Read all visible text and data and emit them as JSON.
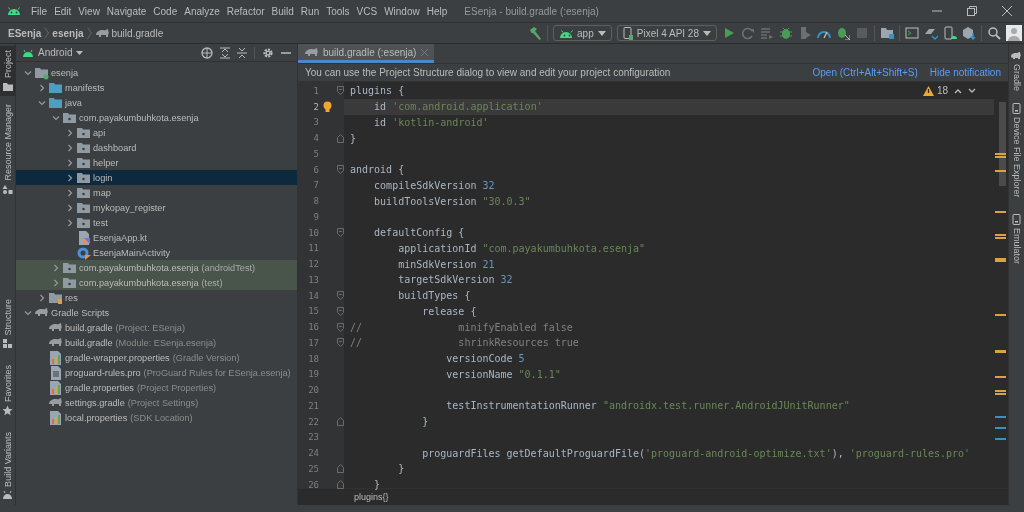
{
  "window": {
    "title": "ESenja - build.gradle (:esenja)"
  },
  "menu": [
    "File",
    "Edit",
    "View",
    "Navigate",
    "Code",
    "Analyze",
    "Refactor",
    "Build",
    "Run",
    "Tools",
    "VCS",
    "Window",
    "Help"
  ],
  "breadcrumb": [
    "ESenja",
    "esenja",
    "build.gradle"
  ],
  "toolbar": {
    "run_config": "app",
    "device": "Pixel 4 API 28"
  },
  "left_tool_tabs": [
    {
      "label": "Project",
      "selected": true,
      "kind": "folder"
    },
    {
      "label": "Resource Manager",
      "selected": false,
      "kind": "shapes"
    },
    {
      "label": "Structure",
      "selected": false,
      "kind": "structure"
    },
    {
      "label": "Favorites",
      "selected": false,
      "kind": "star"
    },
    {
      "label": "Build Variants",
      "selected": false,
      "kind": "android"
    }
  ],
  "right_tool_tabs": [
    {
      "label": "Gradle",
      "selected": false,
      "kind": "gradle"
    },
    {
      "label": "Device File Explorer",
      "selected": false,
      "kind": "device"
    },
    {
      "label": "Emulator",
      "selected": false,
      "kind": "device"
    }
  ],
  "project_panel": {
    "view": "Android",
    "tree": [
      {
        "label": "esenja",
        "kind": "module",
        "expanded": true,
        "selected": false,
        "children": [
          {
            "label": "manifests",
            "kind": "source-folder",
            "expanded": false,
            "selected": false
          },
          {
            "label": "java",
            "kind": "source-folder",
            "expanded": true,
            "selected": false,
            "children": [
              {
                "label": "com.payakumbuhkota.esenja",
                "kind": "package",
                "expanded": true,
                "selected": false,
                "children": [
                  {
                    "label": "api",
                    "kind": "package",
                    "expanded": false,
                    "selected": false
                  },
                  {
                    "label": "dashboard",
                    "kind": "package",
                    "expanded": false,
                    "selected": false
                  },
                  {
                    "label": "helper",
                    "kind": "package",
                    "expanded": false,
                    "selected": false
                  },
                  {
                    "label": "login",
                    "kind": "package",
                    "expanded": false,
                    "selected": true
                  },
                  {
                    "label": "map",
                    "kind": "package",
                    "expanded": false,
                    "selected": false
                  },
                  {
                    "label": "mykopay_register",
                    "kind": "package",
                    "expanded": false,
                    "selected": false
                  },
                  {
                    "label": "test",
                    "kind": "package",
                    "expanded": false,
                    "selected": false
                  },
                  {
                    "label": "EsenjaApp.kt",
                    "kind": "kotlin-file",
                    "selected": false
                  },
                  {
                    "label": "EsenjaMainActivity",
                    "kind": "activity",
                    "selected": false
                  }
                ]
              },
              {
                "label": "com.payakumbuhkota.esenja",
                "hint": "(androidTest)",
                "kind": "test-package",
                "expanded": false,
                "selected": false
              },
              {
                "label": "com.payakumbuhkota.esenja",
                "hint": "(test)",
                "kind": "test-package",
                "expanded": false,
                "selected": false
              }
            ]
          },
          {
            "label": "res",
            "kind": "res-folder",
            "expanded": false,
            "selected": false
          }
        ]
      },
      {
        "label": "Gradle Scripts",
        "kind": "gradle",
        "expanded": true,
        "selected": false,
        "children": [
          {
            "label": "build.gradle",
            "hint": "(Project: ESenja)",
            "kind": "gradle",
            "selected": false
          },
          {
            "label": "build.gradle",
            "hint": "(Module: ESenja.esenja)",
            "kind": "gradle",
            "selected": false
          },
          {
            "label": "gradle-wrapper.properties",
            "hint": "(Gradle Version)",
            "kind": "properties",
            "selected": false
          },
          {
            "label": "proguard-rules.pro",
            "hint": "(ProGuard Rules for ESenja.esenja)",
            "kind": "text-file",
            "selected": false
          },
          {
            "label": "gradle.properties",
            "hint": "(Project Properties)",
            "kind": "properties",
            "selected": false
          },
          {
            "label": "settings.gradle",
            "hint": "(Project Settings)",
            "kind": "gradle",
            "selected": false
          },
          {
            "label": "local.properties",
            "hint": "(SDK Location)",
            "kind": "properties",
            "selected": false
          }
        ]
      }
    ]
  },
  "editor": {
    "tabs": [
      {
        "label": "build.gradle (:esenja)",
        "selected": true
      }
    ],
    "notification": {
      "text": "You can use the Project Structure dialog to view and edit your project configuration",
      "actions": [
        "Open (Ctrl+Alt+Shift+S)",
        "Hide notification"
      ]
    },
    "warnings": "18",
    "lines": [
      {
        "number": "1",
        "current": false,
        "kind": "fold-start",
        "tokens": [
          {
            "text": "plugins {",
            "kind": "plain"
          }
        ]
      },
      {
        "number": "2",
        "current": true,
        "kind": "bulb",
        "tokens": [
          {
            "text": "    id ",
            "kind": "plain"
          },
          {
            "text": "'com.android.application'",
            "kind": "string"
          }
        ]
      },
      {
        "number": "3",
        "current": false,
        "kind": "plain",
        "tokens": [
          {
            "text": "    id ",
            "kind": "plain"
          },
          {
            "text": "'kotlin-android'",
            "kind": "string"
          }
        ]
      },
      {
        "number": "4",
        "current": false,
        "kind": "fold-end",
        "tokens": [
          {
            "text": "}",
            "kind": "plain"
          }
        ]
      },
      {
        "number": "5",
        "current": false,
        "kind": "plain"
      },
      {
        "number": "6",
        "current": false,
        "kind": "fold-start",
        "tokens": [
          {
            "text": "android {",
            "kind": "plain"
          }
        ]
      },
      {
        "number": "7",
        "current": false,
        "kind": "plain",
        "tokens": [
          {
            "text": "    compileSdkVersion ",
            "kind": "plain"
          },
          {
            "text": "32",
            "kind": "number"
          }
        ]
      },
      {
        "number": "8",
        "current": false,
        "kind": "plain",
        "tokens": [
          {
            "text": "    buildToolsVersion ",
            "kind": "plain"
          },
          {
            "text": "\"30.0.3\"",
            "kind": "string"
          }
        ]
      },
      {
        "number": "9",
        "current": false,
        "kind": "plain"
      },
      {
        "number": "10",
        "current": false,
        "kind": "fold-start",
        "tokens": [
          {
            "text": "    defaultConfig {",
            "kind": "plain"
          }
        ]
      },
      {
        "number": "11",
        "current": false,
        "kind": "plain",
        "tokens": [
          {
            "text": "        applicationId ",
            "kind": "plain"
          },
          {
            "text": "\"com.payakumbuhkota.esenja\"",
            "kind": "string"
          }
        ]
      },
      {
        "number": "12",
        "current": false,
        "kind": "plain",
        "tokens": [
          {
            "text": "        minSdkVersion ",
            "kind": "plain"
          },
          {
            "text": "21",
            "kind": "number"
          }
        ]
      },
      {
        "number": "13",
        "current": false,
        "kind": "plain",
        "tokens": [
          {
            "text": "        targetSdkVersion ",
            "kind": "plain"
          },
          {
            "text": "32",
            "kind": "number"
          }
        ]
      },
      {
        "number": "14",
        "current": false,
        "kind": "fold-start",
        "tokens": [
          {
            "text": "        buildTypes {",
            "kind": "plain"
          }
        ]
      },
      {
        "number": "15",
        "current": false,
        "kind": "fold-start",
        "tokens": [
          {
            "text": "            release {",
            "kind": "plain"
          }
        ]
      },
      {
        "number": "16",
        "current": false,
        "kind": "fold-start",
        "tokens": [
          {
            "text": "//                minifyEnabled false",
            "kind": "comment"
          }
        ]
      },
      {
        "number": "17",
        "current": false,
        "kind": "fold-start",
        "tokens": [
          {
            "text": "//                shrinkResources true",
            "kind": "comment"
          }
        ]
      },
      {
        "number": "18",
        "current": false,
        "kind": "plain",
        "tokens": [
          {
            "text": "                versionCode ",
            "kind": "plain"
          },
          {
            "text": "5",
            "kind": "number"
          }
        ]
      },
      {
        "number": "19",
        "current": false,
        "kind": "plain",
        "tokens": [
          {
            "text": "                versionName ",
            "kind": "plain"
          },
          {
            "text": "\"0.1.1\"",
            "kind": "string"
          }
        ]
      },
      {
        "number": "20",
        "current": false,
        "kind": "plain"
      },
      {
        "number": "21",
        "current": false,
        "kind": "plain",
        "tokens": [
          {
            "text": "                testInstrumentationRunner ",
            "kind": "plain"
          },
          {
            "text": "\"androidx.test.runner.AndroidJUnitRunner\"",
            "kind": "string"
          }
        ]
      },
      {
        "number": "22",
        "current": false,
        "kind": "fold-end",
        "tokens": [
          {
            "text": "            }",
            "kind": "plain"
          }
        ]
      },
      {
        "number": "23",
        "current": false,
        "kind": "plain"
      },
      {
        "number": "24",
        "current": false,
        "kind": "plain",
        "tokens": [
          {
            "text": "            proguardFiles getDefaultProguardFile(",
            "kind": "plain"
          },
          {
            "text": "'proguard-android-optimize.txt'",
            "kind": "string"
          },
          {
            "text": "), ",
            "kind": "plain"
          },
          {
            "text": "'proguard-rules.pro'",
            "kind": "string"
          }
        ]
      },
      {
        "number": "25",
        "current": false,
        "kind": "fold-end",
        "tokens": [
          {
            "text": "        }",
            "kind": "plain"
          }
        ]
      },
      {
        "number": "26",
        "current": false,
        "kind": "fold-end",
        "tokens": [
          {
            "text": "    }",
            "kind": "plain"
          }
        ]
      }
    ],
    "breadcrumb": "plugins{}"
  }
}
